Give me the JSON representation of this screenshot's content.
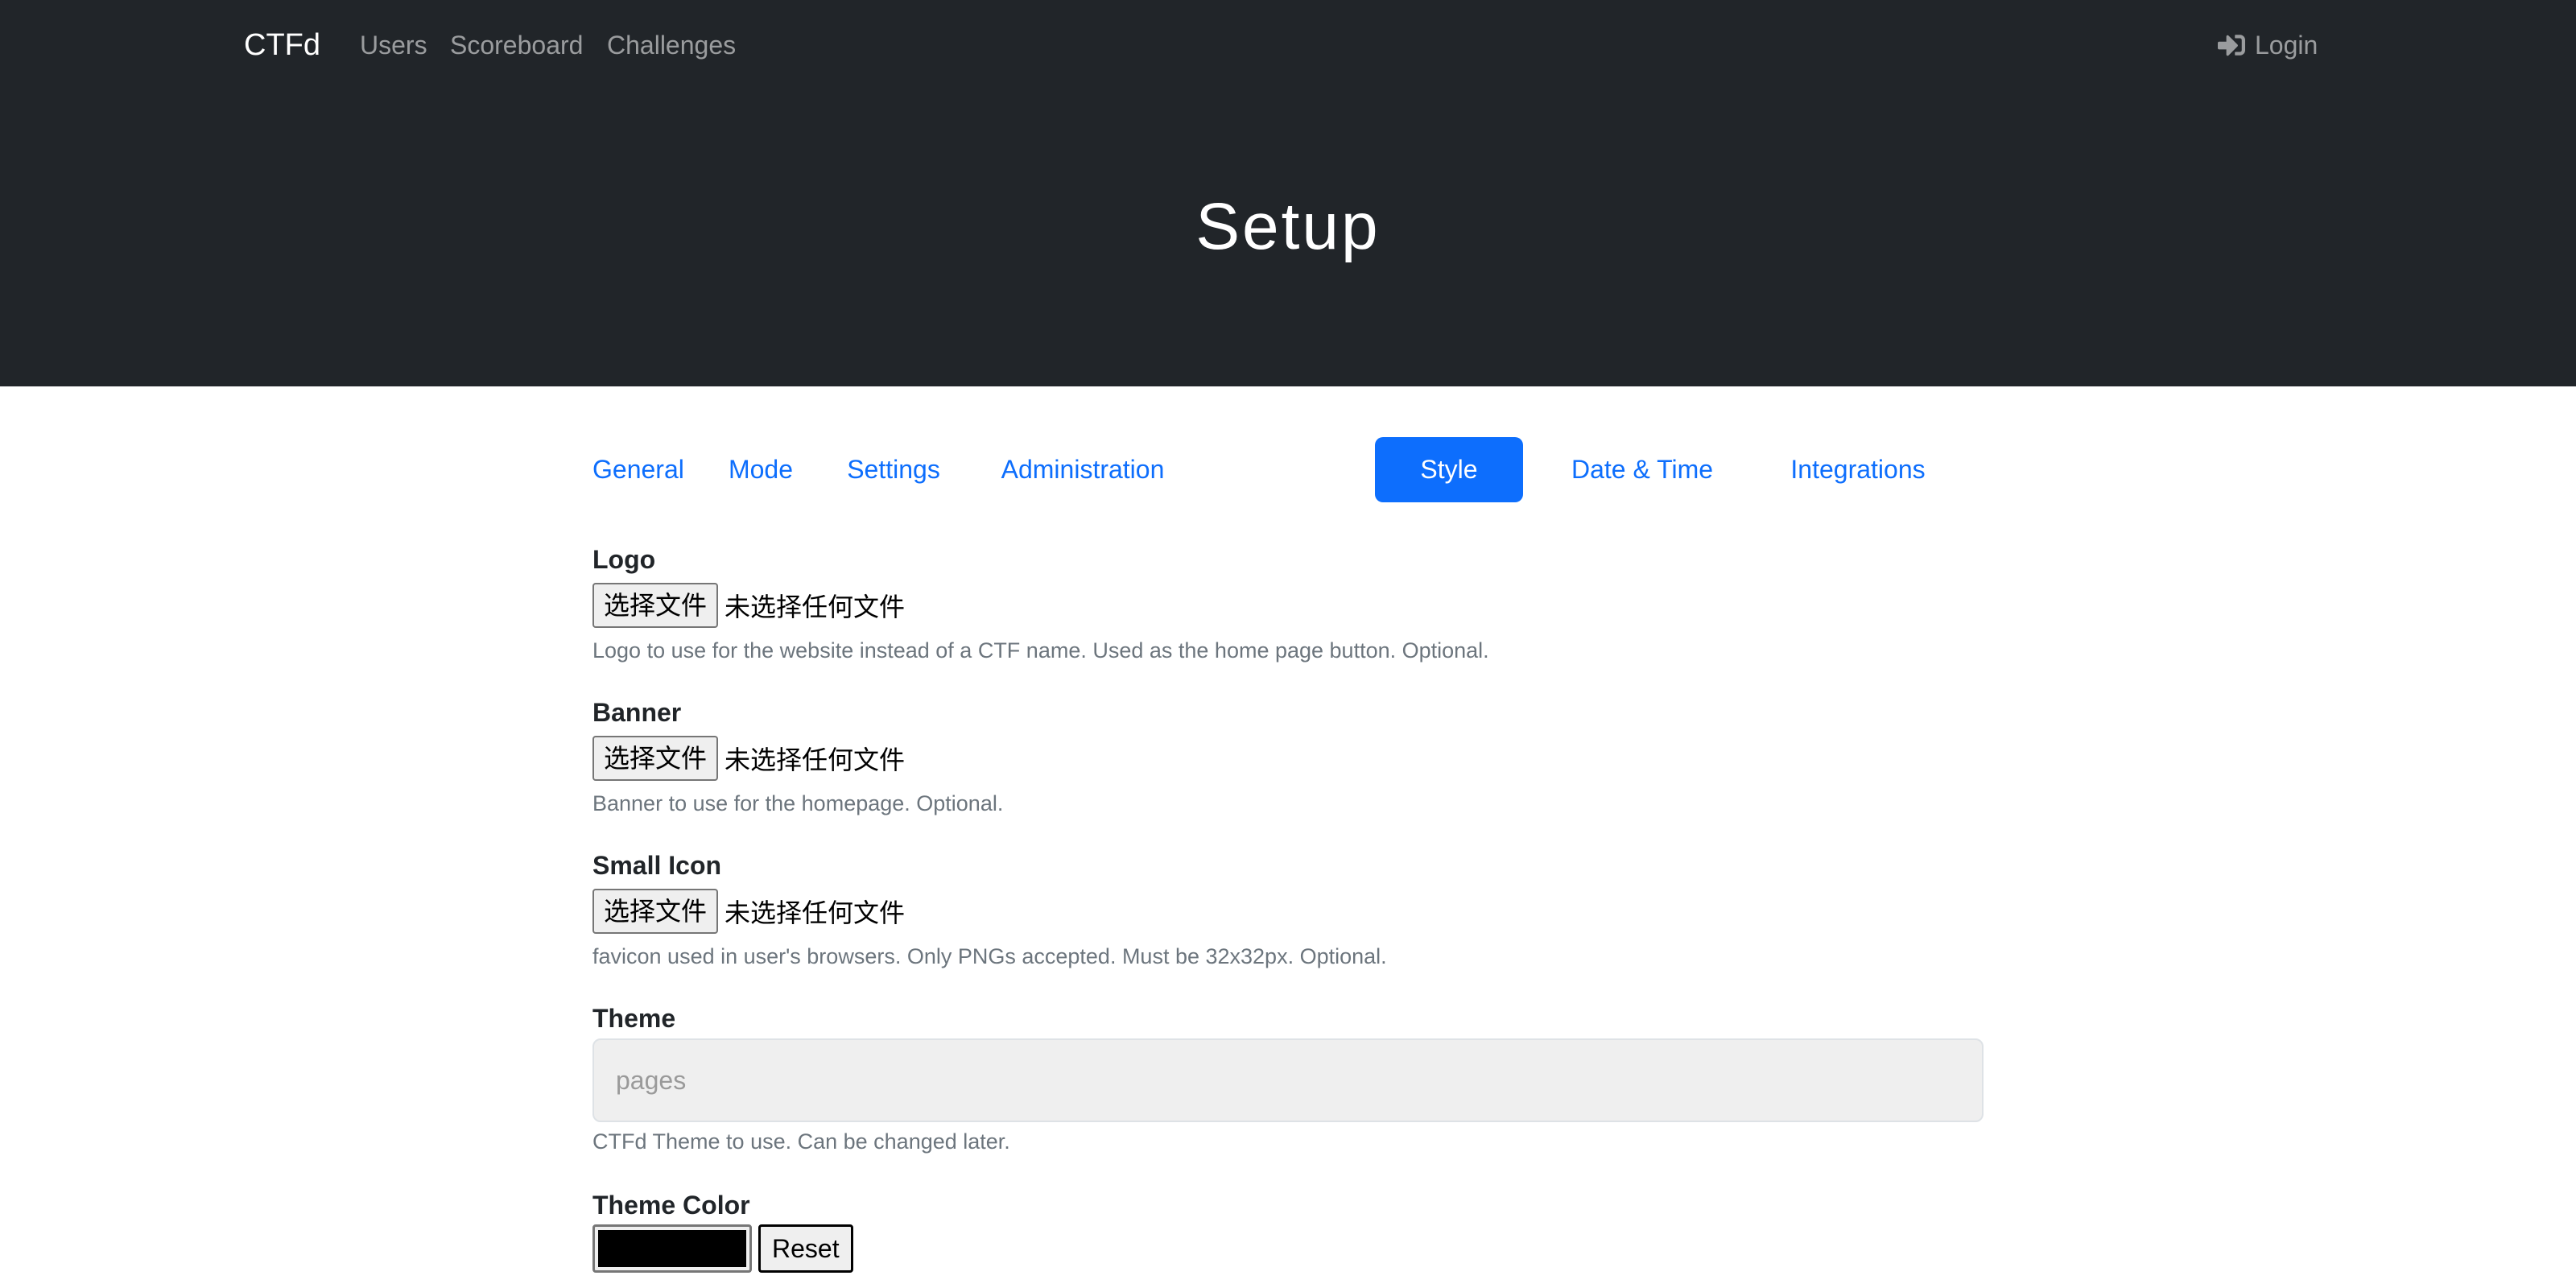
{
  "navbar": {
    "brand": "CTFd",
    "links": [
      "Users",
      "Scoreboard",
      "Challenges"
    ],
    "login": "Login",
    "login_icon": "sign-in-icon"
  },
  "header": {
    "title": "Setup"
  },
  "tabs": [
    {
      "label": "General",
      "active": false
    },
    {
      "label": "Mode",
      "active": false
    },
    {
      "label": "Settings",
      "active": false
    },
    {
      "label": "Administration",
      "active": false
    },
    {
      "label": "Style",
      "active": true
    },
    {
      "label": "Date & Time",
      "active": false
    },
    {
      "label": "Integrations",
      "active": false
    }
  ],
  "form": {
    "logo": {
      "label": "Logo",
      "button": "选择文件",
      "status": "未选择任何文件",
      "help": "Logo to use for the website instead of a CTF name. Used as the home page button. Optional."
    },
    "banner": {
      "label": "Banner",
      "button": "选择文件",
      "status": "未选择任何文件",
      "help": "Banner to use for the homepage. Optional."
    },
    "small_icon": {
      "label": "Small Icon",
      "button": "选择文件",
      "status": "未选择任何文件",
      "help": "favicon used in user's browsers. Only PNGs accepted. Must be 32x32px. Optional."
    },
    "theme": {
      "label": "Theme",
      "value": "pages",
      "help": "CTFd Theme to use. Can be changed later."
    },
    "theme_color": {
      "label": "Theme Color",
      "value": "#000000",
      "reset": "Reset"
    }
  },
  "colors": {
    "navbar_bg": "#212529",
    "accent": "#0d6efd",
    "help_text": "#6c757d"
  }
}
